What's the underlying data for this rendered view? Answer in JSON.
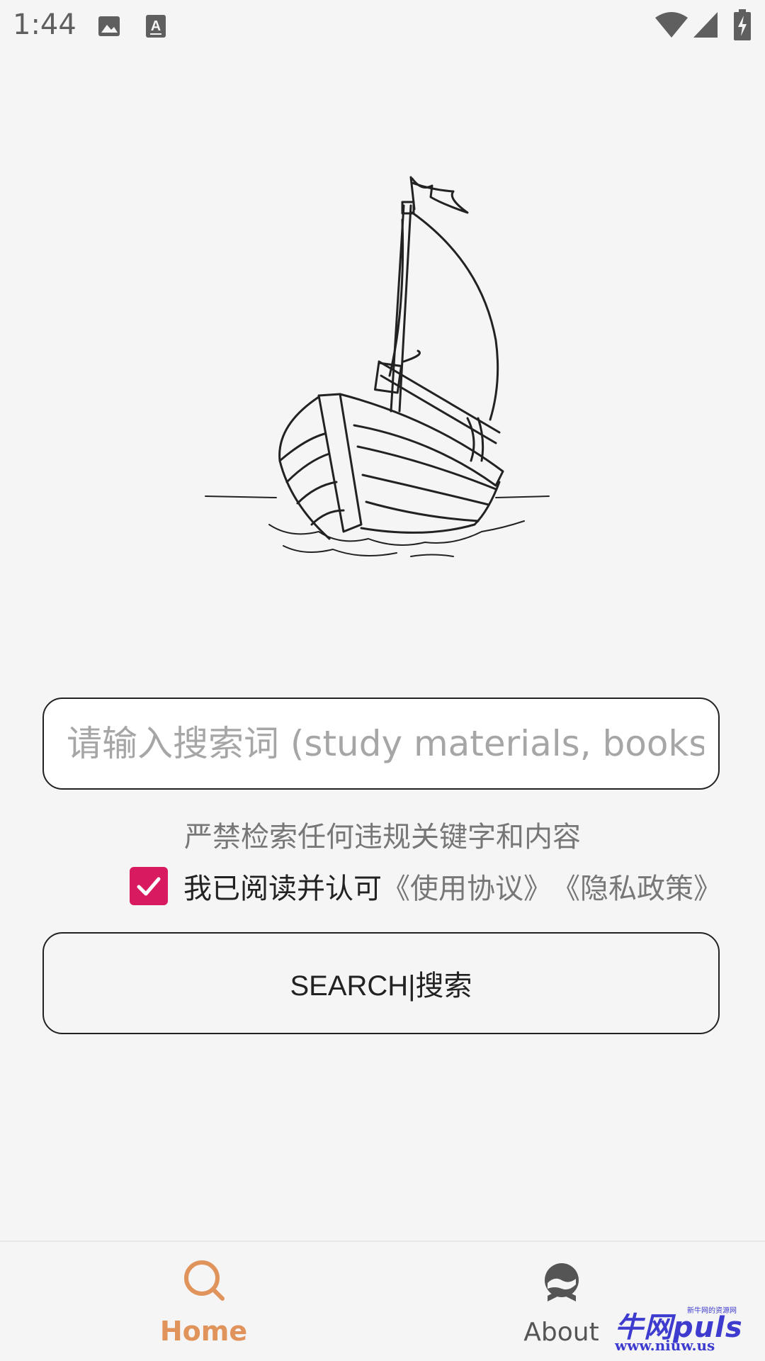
{
  "status_bar": {
    "time": "1:44"
  },
  "search": {
    "placeholder": "请输入搜索词 (study materials, books, etc.)",
    "value": ""
  },
  "warning_text": "严禁检索任何违规关键字和内容",
  "agreement": {
    "checked": true,
    "label": "我已阅读并认可",
    "terms_link": "《使用协议》",
    "privacy_link": "《隐私政策》"
  },
  "search_button": {
    "label": "SEARCH|搜索"
  },
  "bottom_nav": {
    "items": [
      {
        "label": "Home",
        "icon": "search-icon",
        "active": true
      },
      {
        "label": "About",
        "icon": "about-icon",
        "active": false
      }
    ]
  },
  "watermark": {
    "brand": "牛网puls",
    "tagline": "新牛网的资源网",
    "url": "www.niuw.us"
  },
  "colors": {
    "background": "#f5f5f5",
    "checkbox": "#d81b60",
    "active_nav": "#e0935a",
    "watermark": "#3e3bcf"
  }
}
